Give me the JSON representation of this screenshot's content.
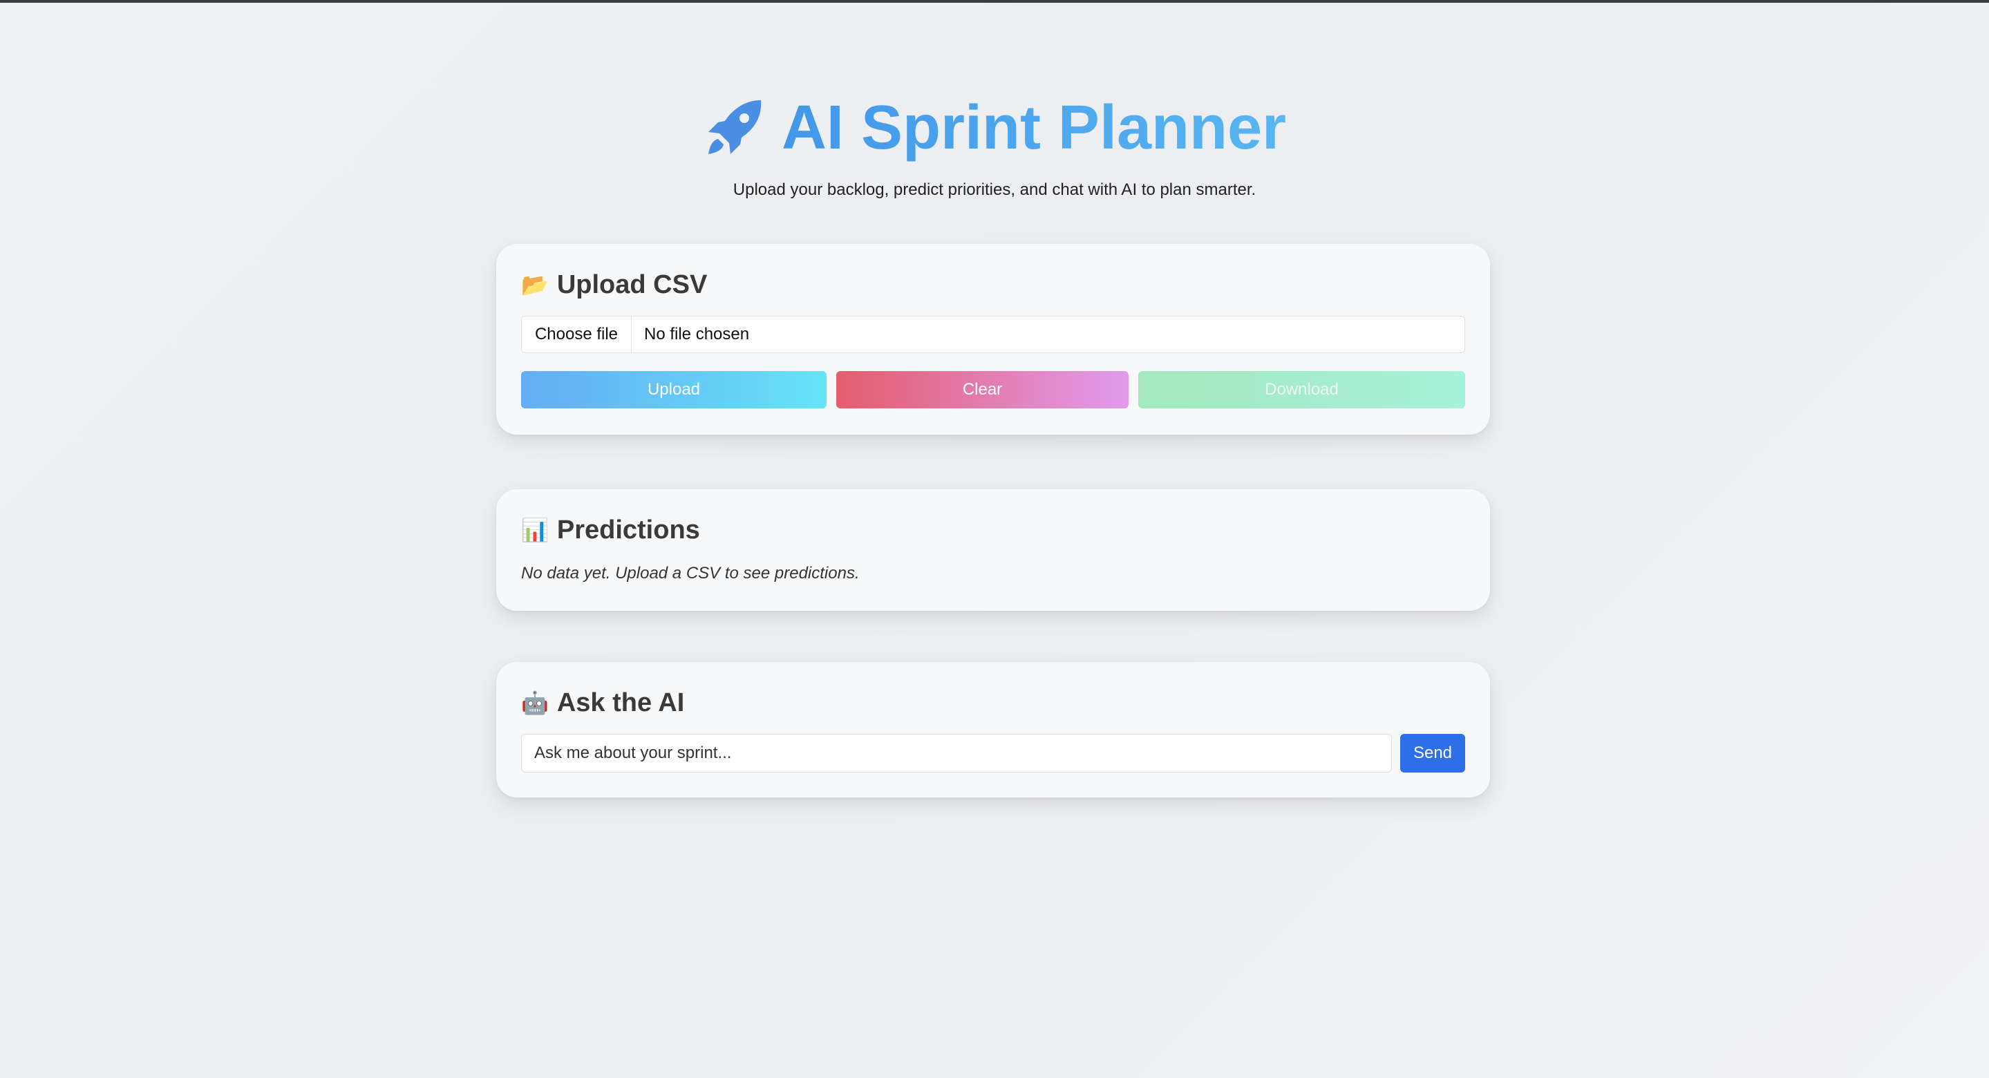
{
  "header": {
    "title": "AI Sprint Planner",
    "title_icon": "rocket-icon",
    "subtitle": "Upload your backlog, predict priorities, and chat with AI to plan smarter."
  },
  "upload": {
    "heading": "Upload CSV",
    "heading_icon": "📂",
    "choose_file_label": "Choose file",
    "file_status": "No file chosen",
    "upload_label": "Upload",
    "clear_label": "Clear",
    "download_label": "Download"
  },
  "predictions": {
    "heading": "Predictions",
    "heading_icon": "📊",
    "empty_message": "No data yet. Upload a CSV to see predictions."
  },
  "ask": {
    "heading": "Ask the AI",
    "heading_icon": "🤖",
    "input_placeholder": "Ask me about your sprint...",
    "send_label": "Send"
  },
  "colors": {
    "title": "#4aa6ef",
    "upload_gradient": [
      "#64acf3",
      "#66e3f7"
    ],
    "clear_gradient": [
      "#e35d6d",
      "#e19bee"
    ],
    "download_gradient": [
      "#a4e8bd",
      "#a6f1da"
    ],
    "send": "#2e6ee6"
  }
}
